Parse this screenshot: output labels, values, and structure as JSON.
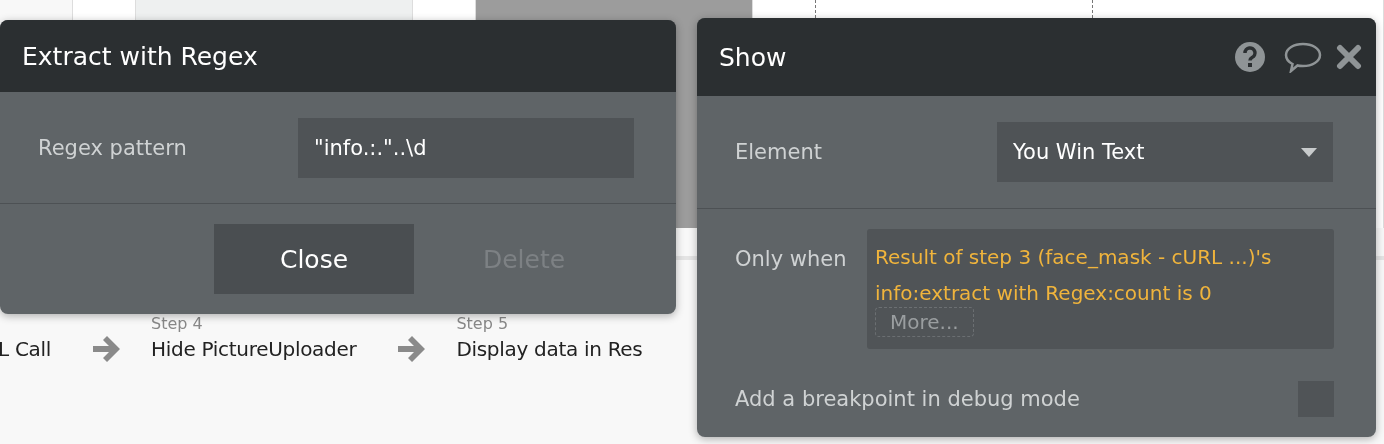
{
  "steps": [
    {
      "title": "L Call"
    },
    {
      "label": "Step 4",
      "title": "Hide PictureUploader"
    },
    {
      "label": "Step 5",
      "title": "Display data in Res"
    }
  ],
  "extract_panel": {
    "title": "Extract with Regex",
    "field": {
      "label": "Regex pattern",
      "value": "\"info.:.\"..\\d"
    },
    "buttons": [
      {
        "label": "Close",
        "disabled": false
      },
      {
        "label": "Delete",
        "disabled": true
      }
    ]
  },
  "show_panel": {
    "title": "Show",
    "element": {
      "label": "Element",
      "value": "You Win Text"
    },
    "only_when": {
      "label": "Only when",
      "expression": "Result of step 3 (face_mask - cURL ...)'s info:extract with Regex:count is 0",
      "more": "More..."
    },
    "breakpoint": {
      "label": "Add a breakpoint in debug mode",
      "checked": false
    }
  }
}
